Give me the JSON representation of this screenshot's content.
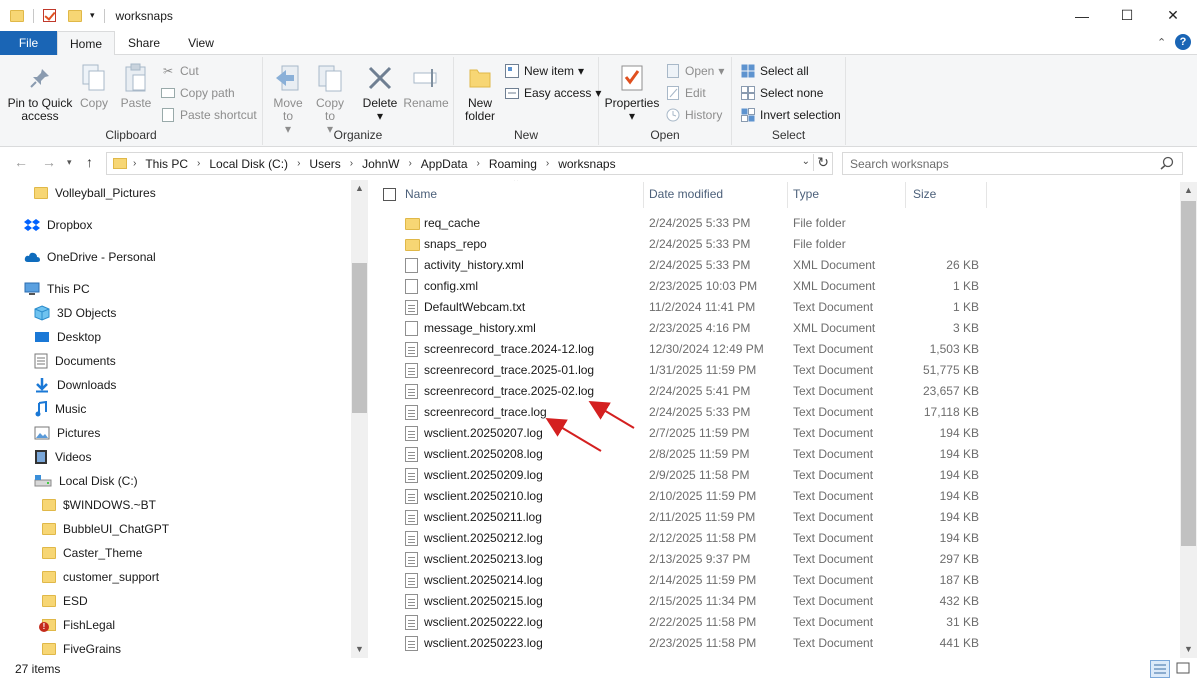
{
  "window": {
    "title": "worksnaps",
    "controls": {
      "minimize": "—",
      "maximize": "☐",
      "close": "✕"
    }
  },
  "tabs": {
    "file": "File",
    "home": "Home",
    "share": "Share",
    "view": "View",
    "expand": "⌃",
    "help": "?"
  },
  "ribbon": {
    "clipboard": {
      "label": "Clipboard",
      "pin": "Pin to Quick access",
      "copy": "Copy",
      "paste": "Paste",
      "cut": "Cut",
      "copy_path": "Copy path",
      "paste_shortcut": "Paste shortcut"
    },
    "organize": {
      "label": "Organize",
      "move_to": "Move to",
      "copy_to": "Copy to",
      "delete": "Delete",
      "rename": "Rename"
    },
    "new": {
      "label": "New",
      "new_folder": "New folder",
      "new_item": "New item",
      "easy_access": "Easy access"
    },
    "open": {
      "label": "Open",
      "properties": "Properties",
      "open": "Open",
      "edit": "Edit",
      "history": "History"
    },
    "select": {
      "label": "Select",
      "select_all": "Select all",
      "select_none": "Select none",
      "invert": "Invert selection"
    }
  },
  "address": {
    "crumbs": [
      "This PC",
      "Local Disk (C:)",
      "Users",
      "JohnW",
      "AppData",
      "Roaming",
      "worksnaps"
    ],
    "search_placeholder": "Search worksnaps"
  },
  "nav": {
    "items": [
      {
        "label": "Volleyball_Pictures",
        "icon": "folder-icon"
      },
      {
        "label": "Dropbox",
        "icon": "dropbox-icon"
      },
      {
        "label": "OneDrive - Personal",
        "icon": "onedrive-icon"
      },
      {
        "label": "This PC",
        "icon": "this-pc-icon"
      },
      {
        "label": "3D Objects",
        "icon": "3d-objects-icon"
      },
      {
        "label": "Desktop",
        "icon": "desktop-icon"
      },
      {
        "label": "Documents",
        "icon": "documents-icon"
      },
      {
        "label": "Downloads",
        "icon": "downloads-icon"
      },
      {
        "label": "Music",
        "icon": "music-icon"
      },
      {
        "label": "Pictures",
        "icon": "pictures-icon"
      },
      {
        "label": "Videos",
        "icon": "videos-icon"
      },
      {
        "label": "Local Disk (C:)",
        "icon": "local-disk-icon"
      },
      {
        "label": "$WINDOWS.~BT",
        "icon": "folder-icon"
      },
      {
        "label": "BubbleUI_ChatGPT",
        "icon": "folder-icon"
      },
      {
        "label": "Caster_Theme",
        "icon": "folder-icon"
      },
      {
        "label": "customer_support",
        "icon": "folder-icon"
      },
      {
        "label": "ESD",
        "icon": "folder-icon"
      },
      {
        "label": "FishLegal",
        "icon": "folder-error-icon"
      },
      {
        "label": "FiveGrains",
        "icon": "folder-icon"
      }
    ]
  },
  "columns": {
    "name": "Name",
    "date": "Date modified",
    "type": "Type",
    "size": "Size"
  },
  "files": [
    {
      "name": "req_cache",
      "date": "2/24/2025 5:33 PM",
      "type": "File folder",
      "size": "",
      "icon": "folder"
    },
    {
      "name": "snaps_repo",
      "date": "2/24/2025 5:33 PM",
      "type": "File folder",
      "size": "",
      "icon": "folder"
    },
    {
      "name": "activity_history.xml",
      "date": "2/24/2025 5:33 PM",
      "type": "XML Document",
      "size": "26 KB",
      "icon": "plain"
    },
    {
      "name": "config.xml",
      "date": "2/23/2025 10:03 PM",
      "type": "XML Document",
      "size": "1 KB",
      "icon": "plain"
    },
    {
      "name": "DefaultWebcam.txt",
      "date": "11/2/2024 11:41 PM",
      "type": "Text Document",
      "size": "1 KB",
      "icon": "doc"
    },
    {
      "name": "message_history.xml",
      "date": "2/23/2025 4:16 PM",
      "type": "XML Document",
      "size": "3 KB",
      "icon": "plain"
    },
    {
      "name": "screenrecord_trace.2024-12.log",
      "date": "12/30/2024 12:49 PM",
      "type": "Text Document",
      "size": "1,503 KB",
      "icon": "doc"
    },
    {
      "name": "screenrecord_trace.2025-01.log",
      "date": "1/31/2025 11:59 PM",
      "type": "Text Document",
      "size": "51,775 KB",
      "icon": "doc"
    },
    {
      "name": "screenrecord_trace.2025-02.log",
      "date": "2/24/2025 5:41 PM",
      "type": "Text Document",
      "size": "23,657 KB",
      "icon": "doc"
    },
    {
      "name": "screenrecord_trace.log",
      "date": "2/24/2025 5:33 PM",
      "type": "Text Document",
      "size": "17,118 KB",
      "icon": "doc"
    },
    {
      "name": "wsclient.20250207.log",
      "date": "2/7/2025 11:59 PM",
      "type": "Text Document",
      "size": "194 KB",
      "icon": "doc"
    },
    {
      "name": "wsclient.20250208.log",
      "date": "2/8/2025 11:59 PM",
      "type": "Text Document",
      "size": "194 KB",
      "icon": "doc"
    },
    {
      "name": "wsclient.20250209.log",
      "date": "2/9/2025 11:58 PM",
      "type": "Text Document",
      "size": "194 KB",
      "icon": "doc"
    },
    {
      "name": "wsclient.20250210.log",
      "date": "2/10/2025 11:59 PM",
      "type": "Text Document",
      "size": "194 KB",
      "icon": "doc"
    },
    {
      "name": "wsclient.20250211.log",
      "date": "2/11/2025 11:59 PM",
      "type": "Text Document",
      "size": "194 KB",
      "icon": "doc"
    },
    {
      "name": "wsclient.20250212.log",
      "date": "2/12/2025 11:58 PM",
      "type": "Text Document",
      "size": "194 KB",
      "icon": "doc"
    },
    {
      "name": "wsclient.20250213.log",
      "date": "2/13/2025 9:37 PM",
      "type": "Text Document",
      "size": "297 KB",
      "icon": "doc"
    },
    {
      "name": "wsclient.20250214.log",
      "date": "2/14/2025 11:59 PM",
      "type": "Text Document",
      "size": "187 KB",
      "icon": "doc"
    },
    {
      "name": "wsclient.20250215.log",
      "date": "2/15/2025 11:34 PM",
      "type": "Text Document",
      "size": "432 KB",
      "icon": "doc"
    },
    {
      "name": "wsclient.20250222.log",
      "date": "2/22/2025 11:58 PM",
      "type": "Text Document",
      "size": "31 KB",
      "icon": "doc"
    },
    {
      "name": "wsclient.20250223.log",
      "date": "2/23/2025 11:58 PM",
      "type": "Text Document",
      "size": "441 KB",
      "icon": "doc"
    }
  ],
  "status": {
    "count": "27 items"
  },
  "colors": {
    "accent": "#1a65b5",
    "annotation": "#d42020",
    "folder": "#f7d674"
  }
}
